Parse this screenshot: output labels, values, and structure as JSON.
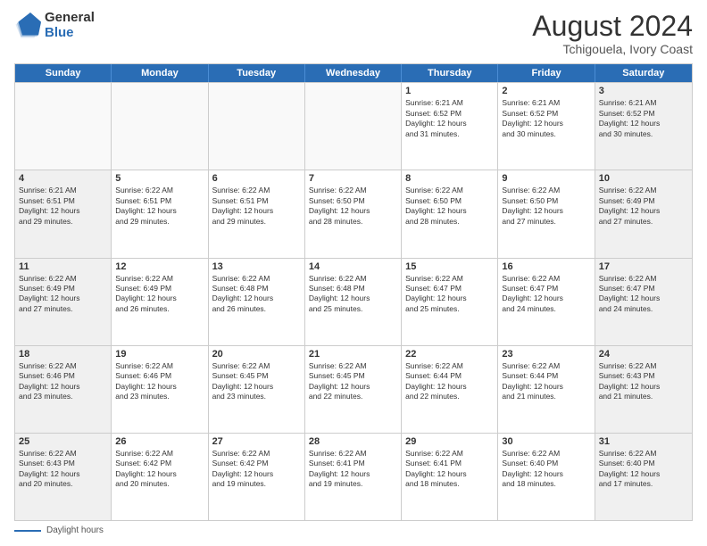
{
  "header": {
    "logo_general": "General",
    "logo_blue": "Blue",
    "main_title": "August 2024",
    "subtitle": "Tchigouela, Ivory Coast"
  },
  "calendar": {
    "days_of_week": [
      "Sunday",
      "Monday",
      "Tuesday",
      "Wednesday",
      "Thursday",
      "Friday",
      "Saturday"
    ],
    "weeks": [
      [
        {
          "day": "",
          "content": "",
          "empty": true
        },
        {
          "day": "",
          "content": "",
          "empty": true
        },
        {
          "day": "",
          "content": "",
          "empty": true
        },
        {
          "day": "",
          "content": "",
          "empty": true
        },
        {
          "day": "1",
          "content": "Sunrise: 6:21 AM\nSunset: 6:52 PM\nDaylight: 12 hours\nand 31 minutes.",
          "empty": false
        },
        {
          "day": "2",
          "content": "Sunrise: 6:21 AM\nSunset: 6:52 PM\nDaylight: 12 hours\nand 30 minutes.",
          "empty": false
        },
        {
          "day": "3",
          "content": "Sunrise: 6:21 AM\nSunset: 6:52 PM\nDaylight: 12 hours\nand 30 minutes.",
          "empty": false
        }
      ],
      [
        {
          "day": "4",
          "content": "Sunrise: 6:21 AM\nSunset: 6:51 PM\nDaylight: 12 hours\nand 29 minutes.",
          "empty": false
        },
        {
          "day": "5",
          "content": "Sunrise: 6:22 AM\nSunset: 6:51 PM\nDaylight: 12 hours\nand 29 minutes.",
          "empty": false
        },
        {
          "day": "6",
          "content": "Sunrise: 6:22 AM\nSunset: 6:51 PM\nDaylight: 12 hours\nand 29 minutes.",
          "empty": false
        },
        {
          "day": "7",
          "content": "Sunrise: 6:22 AM\nSunset: 6:50 PM\nDaylight: 12 hours\nand 28 minutes.",
          "empty": false
        },
        {
          "day": "8",
          "content": "Sunrise: 6:22 AM\nSunset: 6:50 PM\nDaylight: 12 hours\nand 28 minutes.",
          "empty": false
        },
        {
          "day": "9",
          "content": "Sunrise: 6:22 AM\nSunset: 6:50 PM\nDaylight: 12 hours\nand 27 minutes.",
          "empty": false
        },
        {
          "day": "10",
          "content": "Sunrise: 6:22 AM\nSunset: 6:49 PM\nDaylight: 12 hours\nand 27 minutes.",
          "empty": false
        }
      ],
      [
        {
          "day": "11",
          "content": "Sunrise: 6:22 AM\nSunset: 6:49 PM\nDaylight: 12 hours\nand 27 minutes.",
          "empty": false
        },
        {
          "day": "12",
          "content": "Sunrise: 6:22 AM\nSunset: 6:49 PM\nDaylight: 12 hours\nand 26 minutes.",
          "empty": false
        },
        {
          "day": "13",
          "content": "Sunrise: 6:22 AM\nSunset: 6:48 PM\nDaylight: 12 hours\nand 26 minutes.",
          "empty": false
        },
        {
          "day": "14",
          "content": "Sunrise: 6:22 AM\nSunset: 6:48 PM\nDaylight: 12 hours\nand 25 minutes.",
          "empty": false
        },
        {
          "day": "15",
          "content": "Sunrise: 6:22 AM\nSunset: 6:47 PM\nDaylight: 12 hours\nand 25 minutes.",
          "empty": false
        },
        {
          "day": "16",
          "content": "Sunrise: 6:22 AM\nSunset: 6:47 PM\nDaylight: 12 hours\nand 24 minutes.",
          "empty": false
        },
        {
          "day": "17",
          "content": "Sunrise: 6:22 AM\nSunset: 6:47 PM\nDaylight: 12 hours\nand 24 minutes.",
          "empty": false
        }
      ],
      [
        {
          "day": "18",
          "content": "Sunrise: 6:22 AM\nSunset: 6:46 PM\nDaylight: 12 hours\nand 23 minutes.",
          "empty": false
        },
        {
          "day": "19",
          "content": "Sunrise: 6:22 AM\nSunset: 6:46 PM\nDaylight: 12 hours\nand 23 minutes.",
          "empty": false
        },
        {
          "day": "20",
          "content": "Sunrise: 6:22 AM\nSunset: 6:45 PM\nDaylight: 12 hours\nand 23 minutes.",
          "empty": false
        },
        {
          "day": "21",
          "content": "Sunrise: 6:22 AM\nSunset: 6:45 PM\nDaylight: 12 hours\nand 22 minutes.",
          "empty": false
        },
        {
          "day": "22",
          "content": "Sunrise: 6:22 AM\nSunset: 6:44 PM\nDaylight: 12 hours\nand 22 minutes.",
          "empty": false
        },
        {
          "day": "23",
          "content": "Sunrise: 6:22 AM\nSunset: 6:44 PM\nDaylight: 12 hours\nand 21 minutes.",
          "empty": false
        },
        {
          "day": "24",
          "content": "Sunrise: 6:22 AM\nSunset: 6:43 PM\nDaylight: 12 hours\nand 21 minutes.",
          "empty": false
        }
      ],
      [
        {
          "day": "25",
          "content": "Sunrise: 6:22 AM\nSunset: 6:43 PM\nDaylight: 12 hours\nand 20 minutes.",
          "empty": false
        },
        {
          "day": "26",
          "content": "Sunrise: 6:22 AM\nSunset: 6:42 PM\nDaylight: 12 hours\nand 20 minutes.",
          "empty": false
        },
        {
          "day": "27",
          "content": "Sunrise: 6:22 AM\nSunset: 6:42 PM\nDaylight: 12 hours\nand 19 minutes.",
          "empty": false
        },
        {
          "day": "28",
          "content": "Sunrise: 6:22 AM\nSunset: 6:41 PM\nDaylight: 12 hours\nand 19 minutes.",
          "empty": false
        },
        {
          "day": "29",
          "content": "Sunrise: 6:22 AM\nSunset: 6:41 PM\nDaylight: 12 hours\nand 18 minutes.",
          "empty": false
        },
        {
          "day": "30",
          "content": "Sunrise: 6:22 AM\nSunset: 6:40 PM\nDaylight: 12 hours\nand 18 minutes.",
          "empty": false
        },
        {
          "day": "31",
          "content": "Sunrise: 6:22 AM\nSunset: 6:40 PM\nDaylight: 12 hours\nand 17 minutes.",
          "empty": false
        }
      ]
    ]
  },
  "footer": {
    "daylight_label": "Daylight hours"
  }
}
